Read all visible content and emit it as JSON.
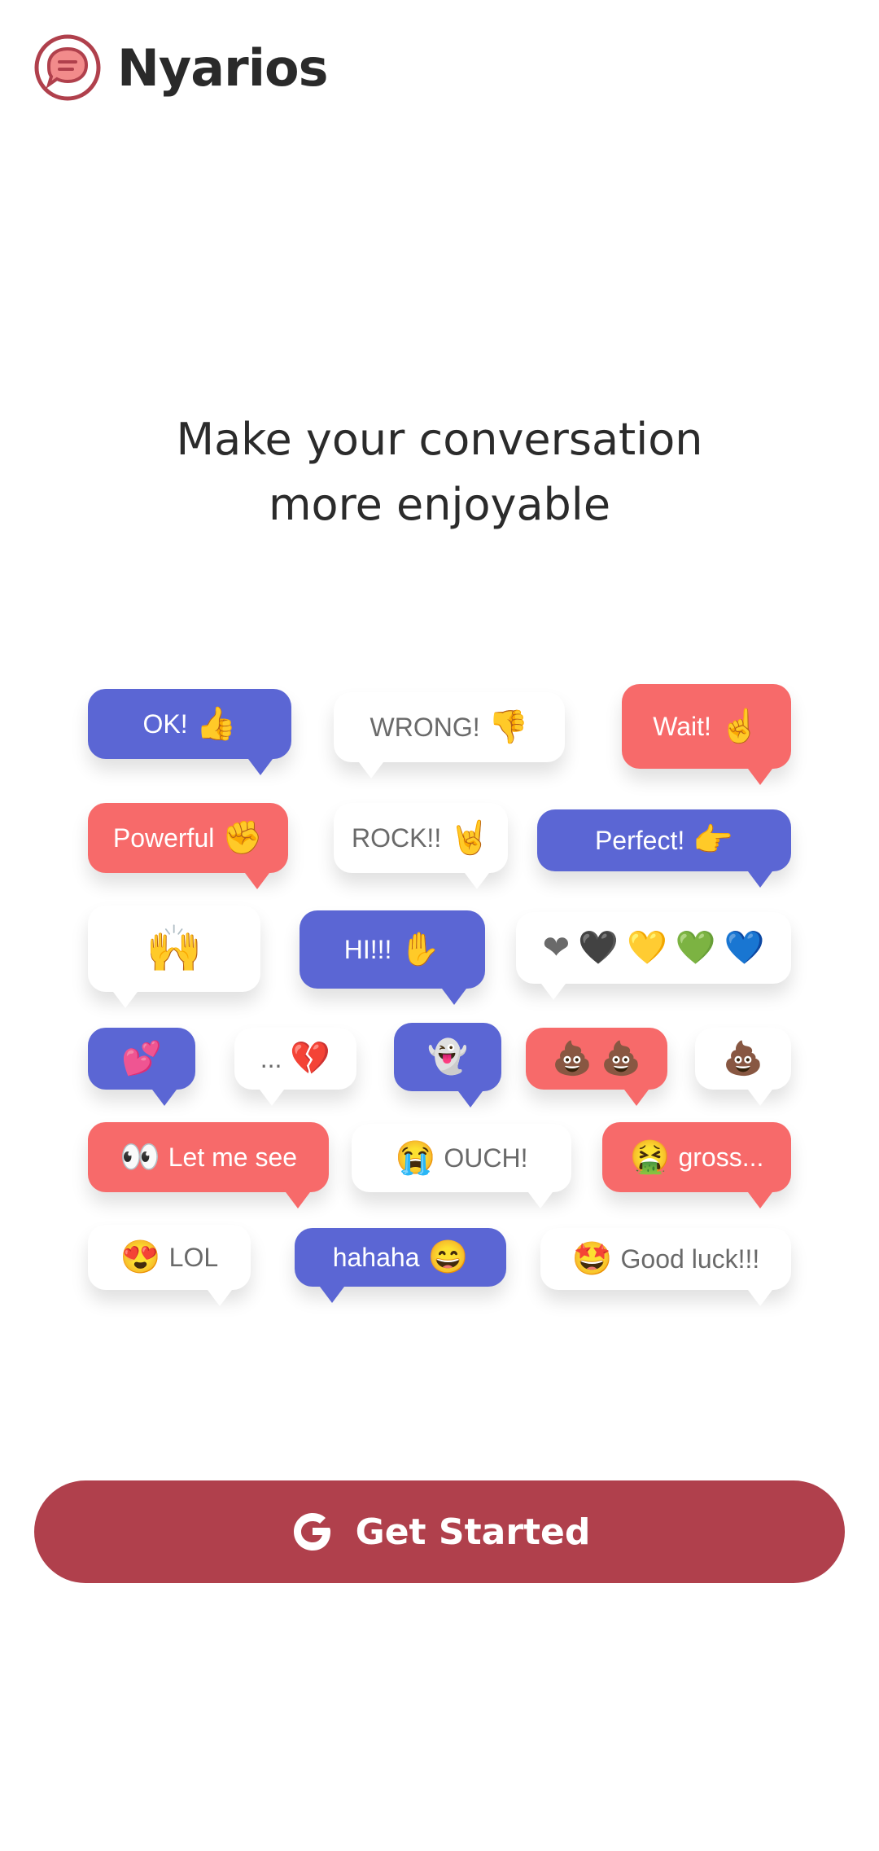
{
  "app": {
    "name": "Nyarios",
    "logo_icon": "chat-bubble-icon",
    "brand_color": "#b0404c"
  },
  "headline": {
    "line1": "Make your conversation",
    "line2": "more enjoyable"
  },
  "stickers": {
    "ok": "OK!",
    "wrong": "WRONG!",
    "wait": "Wait!",
    "powerful": "Powerful",
    "rock": "ROCK!!",
    "perfect": "Perfect!",
    "hi": "HI!!!",
    "broken_heart": "...",
    "let_me_see": "Let me see",
    "ouch": "OUCH!",
    "gross": "gross...",
    "lol": "LOL",
    "hahaha": "hahaha",
    "good_luck": "Good luck!!!",
    "emojis": {
      "thumbs_up": "👍",
      "thumbs_down": "👎",
      "point_up": "☝",
      "fist": "✊",
      "rock_hand": "🤘",
      "point_right": "👉",
      "raised_hands": "🙌",
      "raised_hand": "✋",
      "hearts": [
        "❤",
        "🖤",
        "💛",
        "💚",
        "💙"
      ],
      "two_hearts": "💕",
      "broken": "💔",
      "ghost": "👻",
      "poop": "💩",
      "eyes": "👀",
      "crying": "😭",
      "vomit": "🤮",
      "heart_eyes": "😍",
      "grin": "😄",
      "star_struck": "🤩"
    }
  },
  "cta": {
    "label": "Get Started",
    "icon": "google-g-icon"
  }
}
